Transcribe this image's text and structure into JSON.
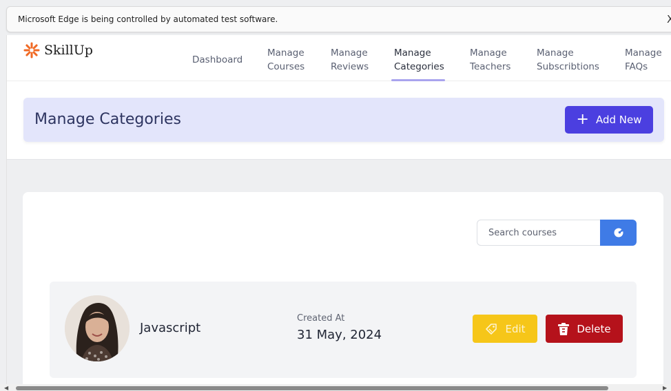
{
  "browser": {
    "infobar_text": "Microsoft Edge is being controlled by automated test software.",
    "close_glyph": "X"
  },
  "brand": {
    "name": "SkillUp",
    "icon": "sunburst-logo-icon",
    "color": "#f06a25"
  },
  "nav": {
    "items": [
      {
        "label": "Dashboard"
      },
      {
        "label": "Manage\nCourses"
      },
      {
        "label": "Manage\nReviews"
      },
      {
        "label": "Manage\nCategories",
        "active": true
      },
      {
        "label": "Manage\nTeachers"
      },
      {
        "label": "Manage\nSubscribtions"
      },
      {
        "label": "Manage\nFAQs"
      }
    ]
  },
  "header": {
    "title": "Manage Categories",
    "add_button_label": "Add New",
    "add_icon": "plus-icon"
  },
  "search": {
    "placeholder": "Search courses",
    "button_icon": "search-icon"
  },
  "categories": [
    {
      "name": "Javascript",
      "created_label": "Created At",
      "created_value": "31 May, 2024",
      "edit_label": "Edit",
      "delete_label": "Delete"
    }
  ],
  "colors": {
    "accent": "#4b3fe0",
    "banner_bg": "#e3e5fb",
    "search_button": "#3f7be6",
    "edit_button": "#f6c619",
    "delete_button": "#b5121b"
  }
}
